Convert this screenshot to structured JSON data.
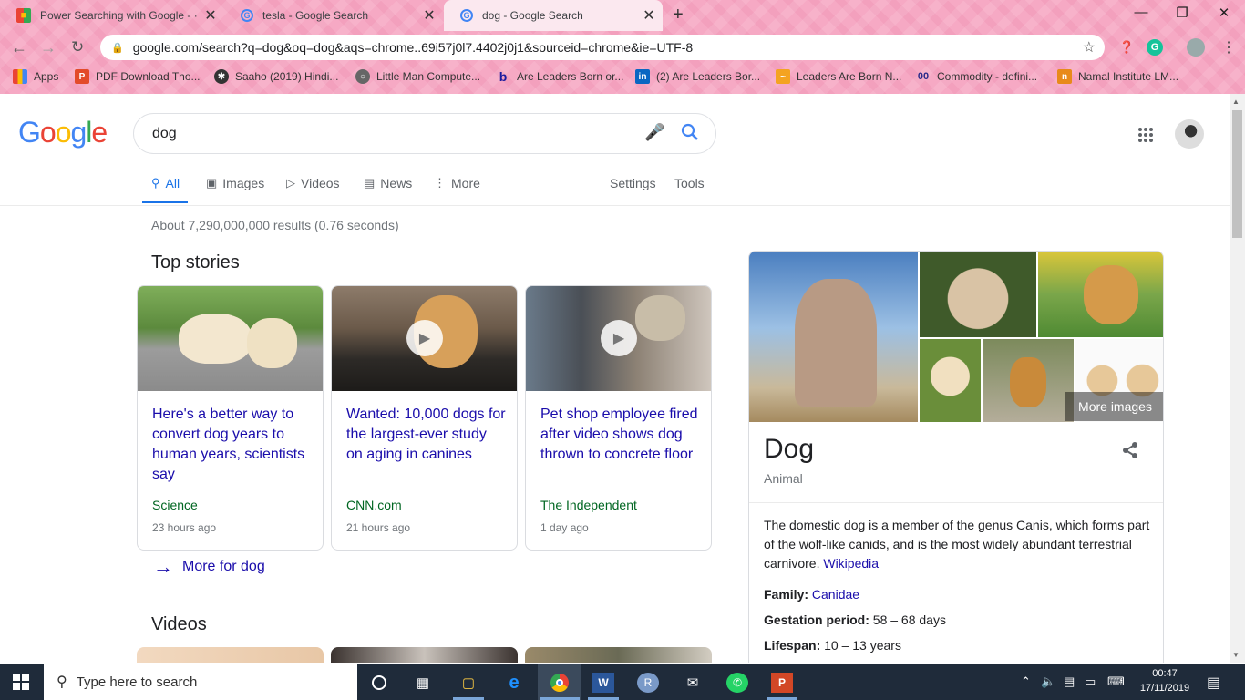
{
  "browser": {
    "tabs": [
      {
        "title": "Power Searching with Google - ·",
        "favicon": "classroom-icon",
        "active": false
      },
      {
        "title": "tesla - Google Search",
        "favicon": "google-g-icon",
        "active": false
      },
      {
        "title": "dog - Google Search",
        "favicon": "google-g-icon",
        "active": true
      }
    ],
    "new_tab": "+",
    "url": "google.com/search?q=dog&oq=dog&aqs=chrome..69i57j0l7.4402j0j1&sourceid=chrome&ie=UTF-8",
    "bookmarks": [
      {
        "label": "Apps",
        "icon": "apps-grid-icon"
      },
      {
        "label": "PDF Download Tho...",
        "icon": "pdf-icon"
      },
      {
        "label": "Saaho (2019) Hindi...",
        "icon": "film-icon"
      },
      {
        "label": "Little Man Compute...",
        "icon": "globe-icon"
      },
      {
        "label": "Are Leaders Born or...",
        "icon": "bing-icon"
      },
      {
        "label": "(2) Are Leaders Bor...",
        "icon": "linkedin-icon"
      },
      {
        "label": "Leaders Are Born N...",
        "icon": "bookmark-icon"
      },
      {
        "label": "Commodity - defini...",
        "icon": "investopedia-icon"
      },
      {
        "label": "Namal Institute LM...",
        "icon": "namal-icon"
      }
    ]
  },
  "search": {
    "logo": "Google",
    "query": "dog",
    "tabs": [
      {
        "label": "All",
        "icon": "search-icon",
        "active": true
      },
      {
        "label": "Images",
        "icon": "image-icon"
      },
      {
        "label": "Videos",
        "icon": "video-icon"
      },
      {
        "label": "News",
        "icon": "news-icon"
      },
      {
        "label": "More",
        "icon": "more-vert-icon"
      }
    ],
    "settings": "Settings",
    "tools": "Tools",
    "result_stats": "About 7,290,000,000 results (0.76 seconds)"
  },
  "top_stories": {
    "heading": "Top stories",
    "stories": [
      {
        "headline": "Here's a better way to convert dog years to human years, scientists say",
        "source": "Science",
        "time": "23 hours ago",
        "video": false
      },
      {
        "headline": "Wanted: 10,000 dogs for the largest-ever study on aging in canines",
        "source": "CNN.com",
        "time": "21 hours ago",
        "video": true
      },
      {
        "headline": "Pet shop employee fired after video shows dog thrown to concrete floor",
        "source": "The Independent",
        "time": "1 day ago",
        "video": true
      }
    ],
    "more_link": "More for dog"
  },
  "videos": {
    "heading": "Videos"
  },
  "knowledge_panel": {
    "more_images": "More images",
    "title": "Dog",
    "subtitle": "Animal",
    "description": "The domestic dog is a member of the genus Canis, which forms part of the wolf-like canids, and is the most widely abundant terrestrial carnivore.",
    "source_link": "Wikipedia",
    "facts": [
      {
        "label": "Family:",
        "value": "Canidae",
        "link": true
      },
      {
        "label": "Gestation period:",
        "value": "58 – 68 days",
        "link": false
      },
      {
        "label": "Lifespan:",
        "value": "10 – 13 years",
        "link": false
      }
    ]
  },
  "taskbar": {
    "search_placeholder": "Type here to search",
    "time": "00:47",
    "date": "17/11/2019",
    "apps": [
      "cortana-icon",
      "task-view-icon",
      "file-explorer-icon",
      "edge-icon",
      "chrome-icon",
      "word-icon",
      "r-icon",
      "mail-icon",
      "whatsapp-icon",
      "powerpoint-icon"
    ]
  }
}
